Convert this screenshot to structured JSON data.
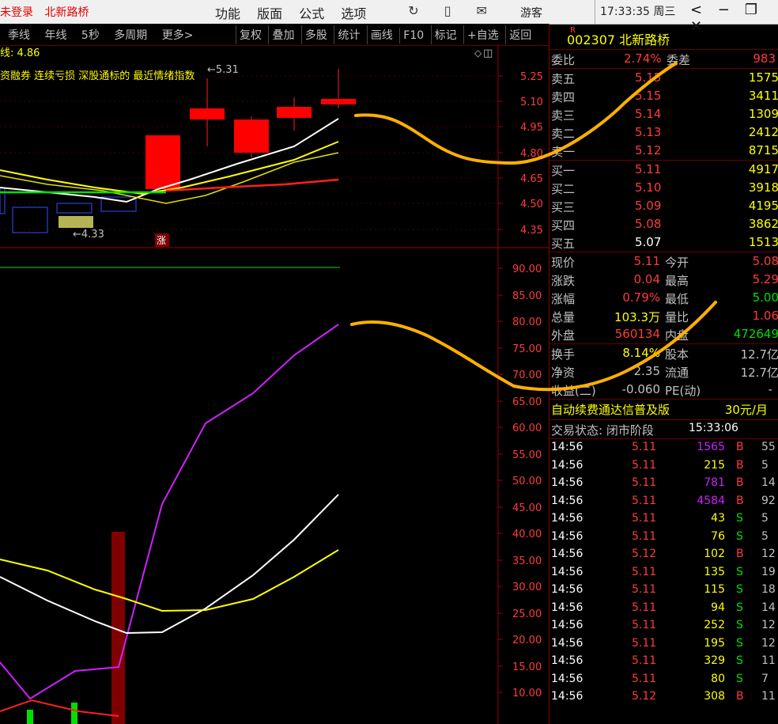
{
  "titlebar": {
    "login_status": "未登录",
    "stock_name": "北新路桥",
    "menu": [
      "功能",
      "版面",
      "公式",
      "选项"
    ],
    "user": "游客",
    "clock": "17:33:35 周三"
  },
  "toolbar": {
    "left": [
      "季线",
      "年线",
      "5秒",
      "多周期",
      "更多>"
    ],
    "right": [
      "复权",
      "叠加",
      "多股",
      "统计",
      "画线",
      "F10",
      "标记",
      "+自选",
      "返回"
    ]
  },
  "main_chart": {
    "line_label": "线: 4.86",
    "indicator_title": "资融券 连续亏损 深股通标的 最近情绪指数",
    "high_label": "5.31",
    "low_label": "4.33",
    "zhang_label": "涨",
    "price_ticks": [
      "5.25",
      "5.10",
      "4.95",
      "4.80",
      "4.65",
      "4.50",
      "4.35"
    ],
    "indicator_ticks": [
      "90.00",
      "85.00",
      "80.00",
      "75.00",
      "70.00",
      "65.00",
      "60.00",
      "55.00",
      "50.00",
      "45.00",
      "40.00",
      "35.00",
      "30.00",
      "25.00",
      "20.00",
      "15.00",
      "10.00"
    ]
  },
  "quote": {
    "code": "002307",
    "name": "北新路桥",
    "sup": "R",
    "weibi_label": "委比",
    "weibi_value": "2.74%",
    "weicha_label": "委差",
    "weicha_value": "983",
    "asks": [
      {
        "label": "卖五",
        "price": "5.15",
        "vol": "1575"
      },
      {
        "label": "卖四",
        "price": "5.15",
        "vol": "3411"
      },
      {
        "label": "卖三",
        "price": "5.14",
        "vol": "1309"
      },
      {
        "label": "卖二",
        "price": "5.13",
        "vol": "2412"
      },
      {
        "label": "卖一",
        "price": "5.12",
        "vol": "8715"
      }
    ],
    "bids": [
      {
        "label": "买一",
        "price": "5.11",
        "vol": "4917"
      },
      {
        "label": "买二",
        "price": "5.10",
        "vol": "3918"
      },
      {
        "label": "买三",
        "price": "5.09",
        "vol": "4195"
      },
      {
        "label": "买四",
        "price": "5.08",
        "vol": "3862"
      },
      {
        "label": "买五",
        "price": "5.07",
        "vol": "1513"
      }
    ],
    "stats": [
      {
        "l1": "现价",
        "v1": "5.11",
        "l2": "今开",
        "v2": "5.08"
      },
      {
        "l1": "涨跌",
        "v1": "0.04",
        "l2": "最高",
        "v2": "5.29"
      },
      {
        "l1": "涨幅",
        "v1": "0.79%",
        "l2": "最低",
        "v2": "5.00"
      },
      {
        "l1": "总量",
        "v1": "103.3万",
        "l2": "量比",
        "v2": "1.06"
      },
      {
        "l1": "外盘",
        "v1": "560134",
        "l2": "内盘",
        "v2": "472649"
      }
    ],
    "stats2": [
      {
        "l1": "换手",
        "v1": "8.14%",
        "l2": "股本",
        "v2": "12.7亿"
      },
      {
        "l1": "净资",
        "v1": "2.35",
        "l2": "流通",
        "v2": "12.7亿"
      },
      {
        "l1": "收益(二)",
        "v1": "-0.060",
        "l2": "PE(动)",
        "v2": "-"
      }
    ],
    "ad_text": "自动续费通达信普及版",
    "ad_price": "30元/月",
    "state_label": "交易状态: 闭市阶段",
    "state_time": "15:33:06"
  },
  "ticks": [
    {
      "t": "14:56",
      "p": "5.11",
      "v": "1565",
      "d": "B",
      "n": "55"
    },
    {
      "t": "14:56",
      "p": "5.11",
      "v": "215",
      "d": "B",
      "n": "5"
    },
    {
      "t": "14:56",
      "p": "5.11",
      "v": "781",
      "d": "B",
      "n": "14"
    },
    {
      "t": "14:56",
      "p": "5.11",
      "v": "4584",
      "d": "B",
      "n": "92"
    },
    {
      "t": "14:56",
      "p": "5.11",
      "v": "43",
      "d": "S",
      "n": "5"
    },
    {
      "t": "14:56",
      "p": "5.11",
      "v": "76",
      "d": "S",
      "n": "5"
    },
    {
      "t": "14:56",
      "p": "5.12",
      "v": "102",
      "d": "B",
      "n": "12"
    },
    {
      "t": "14:56",
      "p": "5.11",
      "v": "135",
      "d": "S",
      "n": "19"
    },
    {
      "t": "14:56",
      "p": "5.11",
      "v": "115",
      "d": "S",
      "n": "18"
    },
    {
      "t": "14:56",
      "p": "5.11",
      "v": "94",
      "d": "S",
      "n": "14"
    },
    {
      "t": "14:56",
      "p": "5.11",
      "v": "252",
      "d": "S",
      "n": "12"
    },
    {
      "t": "14:56",
      "p": "5.11",
      "v": "195",
      "d": "S",
      "n": "12"
    },
    {
      "t": "14:56",
      "p": "5.11",
      "v": "329",
      "d": "S",
      "n": "11"
    },
    {
      "t": "14:56",
      "p": "5.11",
      "v": "80",
      "d": "S",
      "n": "7"
    },
    {
      "t": "14:56",
      "p": "5.12",
      "v": "308",
      "d": "B",
      "n": "11"
    }
  ],
  "colors": {
    "up": "#ff3b3b",
    "down": "#00e000",
    "flat": "#ffffff",
    "axis": "#a00000",
    "highlight": "#ffff00"
  }
}
